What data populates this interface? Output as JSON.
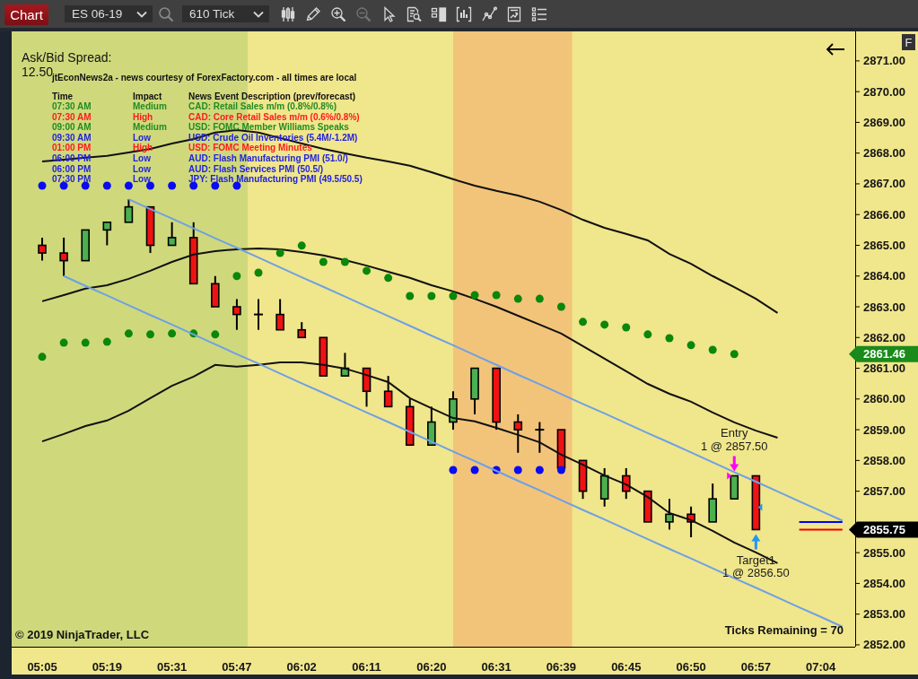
{
  "toolbar": {
    "title_button": "Chart",
    "instrument": "ES 06-19",
    "interval": "610 Tick",
    "tools": [
      {
        "kind": "candles",
        "disabled": false
      },
      {
        "kind": "pencil",
        "disabled": false
      },
      {
        "kind": "zoomin",
        "disabled": false
      },
      {
        "kind": "zoomout",
        "disabled": true
      },
      {
        "kind": "pointer",
        "disabled": false
      },
      {
        "kind": "finddoc",
        "disabled": false
      },
      {
        "kind": "panels",
        "disabled": false
      },
      {
        "kind": "indicators",
        "disabled": false
      },
      {
        "kind": "nodes",
        "disabled": false
      },
      {
        "kind": "report",
        "disabled": false
      },
      {
        "kind": "list",
        "disabled": false
      }
    ]
  },
  "chart": {
    "axis_button": "F",
    "spread_label": "Ask/Bid Spread:",
    "spread_value": "12.50",
    "news": {
      "title": "jtEconNews2a - news courtesy of ForexFactory.com - all times are local",
      "columns": [
        "Time",
        "Impact",
        "News Event Description (prev/forecast)"
      ],
      "rows": [
        {
          "time": "07:30 AM",
          "impact": "Medium",
          "event": "CAD: Retail Sales m/m (0.8%/0.8%)",
          "color": "#228b22"
        },
        {
          "time": "07:30 AM",
          "impact": "High",
          "event": "CAD: Core Retail Sales m/m (0.6%/0.8%)",
          "color": "#ff1a1a"
        },
        {
          "time": "09:00 AM",
          "impact": "Medium",
          "event": "USD: FOMC Member Williams Speaks",
          "color": "#228b22"
        },
        {
          "time": "09:30 AM",
          "impact": "Low",
          "event": "USD: Crude Oil Inventories (5.4M/-1.2M)",
          "color": "#2222dd"
        },
        {
          "time": "01:00 PM",
          "impact": "High",
          "event": "USD: FOMC Meeting Minutes",
          "color": "#ff1a1a"
        },
        {
          "time": "06:00 PM",
          "impact": "Low",
          "event": "AUD: Flash Manufacturing PMI (51.0/)",
          "color": "#2222dd"
        },
        {
          "time": "06:00 PM",
          "impact": "Low",
          "event": "AUD: Flash Services PMI (50.5/)",
          "color": "#2222dd"
        },
        {
          "time": "07:30 PM",
          "impact": "Low",
          "event": "JPY: Flash Manufacturing PMI (49.5/50.5)",
          "color": "#2222dd"
        }
      ]
    },
    "orders": [
      {
        "kind": "entry",
        "label": "Entry",
        "text": "1 @ 2857.50",
        "color": "#ff00ff"
      },
      {
        "kind": "target",
        "label": "Target1",
        "text": "1 @ 2856.50",
        "color": "#2196f3"
      }
    ],
    "price_tags": [
      {
        "kind": "indicator",
        "label": "2861.46",
        "color": "#1a8a1a"
      },
      {
        "kind": "last",
        "label": "2855.75",
        "color": "#000000"
      }
    ],
    "copyright": "© 2019 NinjaTrader, LLC",
    "ticks_remaining": "Ticks Remaining = 70",
    "chart_data": {
      "type": "candlestick",
      "categories": [
        "05:05",
        null,
        null,
        "05:19",
        null,
        null,
        "05:31",
        null,
        null,
        "05:47",
        null,
        null,
        "06:02",
        null,
        null,
        "06:11",
        null,
        null,
        "06:20",
        null,
        null,
        "06:31",
        null,
        null,
        "06:39",
        null,
        null,
        "06:45",
        null,
        null,
        "06:50",
        null,
        null,
        "06:57",
        null,
        null,
        "07:04",
        null
      ],
      "ohlc": [
        [
          2865.0,
          2865.25,
          2864.5,
          2864.75
        ],
        [
          2864.75,
          2865.25,
          2864.0,
          2864.5
        ],
        [
          2864.5,
          2865.5,
          2864.5,
          2865.5
        ],
        [
          2865.5,
          2865.75,
          2865.0,
          2865.75
        ],
        [
          2865.75,
          2866.5,
          2865.75,
          2866.25
        ],
        [
          2866.25,
          2866.25,
          2864.75,
          2865.0
        ],
        [
          2865.0,
          2865.75,
          2865.0,
          2865.25
        ],
        [
          2865.25,
          2865.75,
          2863.75,
          2863.75
        ],
        [
          2863.75,
          2864.0,
          2863.0,
          2863.0
        ],
        [
          2863.0,
          2863.25,
          2862.25,
          2862.75
        ],
        [
          2862.75,
          2863.25,
          2862.25,
          2862.75
        ],
        [
          2862.75,
          2863.25,
          2862.25,
          2862.25
        ],
        [
          2862.25,
          2862.5,
          2862.0,
          2862.0
        ],
        [
          2862.0,
          2862.0,
          2860.75,
          2860.75
        ],
        [
          2860.75,
          2861.5,
          2860.75,
          2861.0
        ],
        [
          2861.0,
          2861.0,
          2859.75,
          2860.25
        ],
        [
          2860.25,
          2860.75,
          2859.75,
          2859.75
        ],
        [
          2859.75,
          2860.0,
          2858.5,
          2858.5
        ],
        [
          2858.5,
          2859.75,
          2858.5,
          2859.25
        ],
        [
          2859.25,
          2860.25,
          2859.0,
          2860.0
        ],
        [
          2860.0,
          2861.0,
          2859.5,
          2861.0
        ],
        [
          2861.0,
          2861.0,
          2859.0,
          2859.25
        ],
        [
          2859.25,
          2859.5,
          2858.25,
          2859.0
        ],
        [
          2859.0,
          2859.25,
          2858.25,
          2859.0
        ],
        [
          2859.0,
          2859.0,
          2857.75,
          2857.75
        ],
        [
          2858.0,
          2858.0,
          2856.75,
          2857.0
        ],
        [
          2856.75,
          2857.75,
          2856.5,
          2857.5
        ],
        [
          2857.5,
          2857.75,
          2856.75,
          2857.0
        ],
        [
          2857.0,
          2857.0,
          2856.0,
          2856.0
        ],
        [
          2856.0,
          2856.75,
          2855.75,
          2856.25
        ],
        [
          2856.25,
          2856.5,
          2855.5,
          2856.0
        ],
        [
          2856.0,
          2857.25,
          2856.0,
          2856.75
        ],
        [
          2856.75,
          2857.5,
          2856.75,
          2857.5
        ],
        [
          2857.5,
          2857.5,
          2855.75,
          2855.75
        ],
        null,
        null,
        null,
        null
      ],
      "series": [
        {
          "type": "line",
          "color": "#111111",
          "values": [
            2867.73,
            2867.79,
            2867.85,
            2867.91,
            2868.02,
            2868.14,
            2868.31,
            2868.46,
            2868.67,
            2868.75,
            2868.67,
            2868.49,
            2868.31,
            2868.14,
            2867.99,
            2867.85,
            2867.73,
            2867.59,
            2867.38,
            2867.15,
            2866.94,
            2866.77,
            2866.62,
            2866.42,
            2866.15,
            2865.83,
            2865.57,
            2865.37,
            2865.16,
            2864.72,
            2864.4,
            2864.0,
            2863.64,
            2863.26,
            2862.8,
            null,
            null,
            null
          ]
        },
        {
          "type": "line",
          "color": "#111111",
          "values": [
            2863.18,
            2863.38,
            2863.59,
            2863.7,
            2863.91,
            2864.17,
            2864.46,
            2864.7,
            2864.81,
            2864.87,
            2864.9,
            2864.87,
            2864.78,
            2864.67,
            2864.52,
            2864.34,
            2864.14,
            2863.94,
            2863.7,
            2863.5,
            2863.26,
            2863.0,
            2862.71,
            2862.42,
            2862.13,
            2861.72,
            2861.31,
            2860.9,
            2860.49,
            2860.17,
            2859.91,
            2859.56,
            2859.24,
            2858.97,
            2858.74,
            null,
            null,
            null
          ]
        },
        {
          "type": "line",
          "color": "#111111",
          "values": [
            2858.62,
            2858.86,
            2859.12,
            2859.3,
            2859.62,
            2860.03,
            2860.43,
            2860.73,
            2861.11,
            2861.05,
            2861.11,
            2861.19,
            2861.19,
            2861.11,
            2860.99,
            2860.78,
            2860.55,
            2860.03,
            2859.7,
            2859.38,
            2859.27,
            2859.06,
            2858.83,
            2858.59,
            2858.19,
            2857.86,
            2857.51,
            2857.22,
            2856.81,
            2856.29,
            2856.06,
            2855.71,
            2855.33,
            2855.01,
            2854.66,
            null,
            null,
            null
          ]
        },
        {
          "type": "scatter",
          "color": "#0b870b",
          "values": [
            2861.37,
            2861.83,
            2861.83,
            2861.86,
            2862.13,
            2862.1,
            2862.13,
            2862.13,
            2862.1,
            2864.0,
            2864.11,
            2864.75,
            2864.99,
            2864.46,
            2864.46,
            2864.17,
            2863.94,
            2863.35,
            2863.35,
            2863.35,
            2863.38,
            2863.38,
            2863.26,
            2863.26,
            2863.0,
            2862.51,
            2862.42,
            2862.33,
            2862.1,
            2861.98,
            2861.75,
            2861.6,
            2861.46,
            null,
            null,
            null,
            null,
            null
          ]
        },
        {
          "type": "scatter",
          "color": "#0b0bf0",
          "values": [
            2866.94,
            2866.94,
            2866.94,
            2866.94,
            2866.94,
            2866.94,
            2866.94,
            2866.94,
            2866.94,
            2866.94,
            null,
            null,
            null,
            null,
            null,
            null,
            null,
            null,
            null,
            2857.69,
            2857.69,
            2857.69,
            2857.69,
            2857.69,
            2857.69,
            null,
            null,
            null,
            null,
            null,
            null,
            null,
            null,
            null,
            null,
            null,
            null,
            null
          ]
        },
        {
          "type": "line",
          "color": "#6fa0e6",
          "values": [
            null,
            null,
            null,
            null,
            2866.5,
            2866.18,
            2865.87,
            2865.55,
            2865.23,
            2864.92,
            2864.6,
            2864.28,
            2863.96,
            2863.65,
            2863.33,
            2863.01,
            2862.7,
            2862.38,
            2862.06,
            2861.75,
            2861.43,
            2861.11,
            2860.79,
            2860.48,
            2860.16,
            2859.84,
            2859.53,
            2859.21,
            2858.89,
            2858.58,
            2858.26,
            2857.94,
            2857.62,
            2857.31,
            2856.99,
            2856.67,
            2856.36,
            2856.04
          ]
        },
        {
          "type": "line",
          "color": "#6fa0e6",
          "values": [
            null,
            2864.0,
            2863.68,
            2863.37,
            2863.05,
            2862.73,
            2862.42,
            2862.1,
            2861.78,
            2861.46,
            2861.15,
            2860.83,
            2860.51,
            2860.2,
            2859.88,
            2859.56,
            2859.25,
            2858.93,
            2858.61,
            2858.29,
            2857.98,
            2857.66,
            2857.34,
            2857.03,
            2856.71,
            2856.39,
            2856.08,
            2855.76,
            2855.44,
            2855.12,
            2854.81,
            2854.49,
            2854.17,
            2853.86,
            2853.54,
            2853.22,
            2852.91,
            2852.59
          ]
        },
        {
          "type": "line",
          "color": "#0000ee",
          "values": [
            null,
            null,
            null,
            null,
            null,
            null,
            null,
            null,
            null,
            null,
            null,
            null,
            null,
            null,
            null,
            null,
            null,
            null,
            null,
            null,
            null,
            null,
            null,
            null,
            null,
            null,
            null,
            null,
            null,
            null,
            null,
            null,
            null,
            null,
            null,
            2856.0,
            2856.0,
            2856.0
          ]
        },
        {
          "type": "line",
          "color": "#ee0000",
          "values": [
            null,
            null,
            null,
            null,
            null,
            null,
            null,
            null,
            null,
            null,
            null,
            null,
            null,
            null,
            null,
            null,
            null,
            null,
            null,
            null,
            null,
            null,
            null,
            null,
            null,
            null,
            null,
            null,
            null,
            null,
            null,
            null,
            null,
            null,
            null,
            2855.75,
            2855.75,
            2855.75
          ]
        }
      ],
      "ylim": [
        2851.94,
        2871.96
      ],
      "yticks": [
        {
          "value": 2852,
          "label": "2852.00"
        },
        {
          "value": 2853,
          "label": "2853.00"
        },
        {
          "value": 2854,
          "label": "2854.00"
        },
        {
          "value": 2855,
          "label": "2855.00"
        },
        {
          "value": 2857,
          "label": "2857.00"
        },
        {
          "value": 2858,
          "label": "2858.00"
        },
        {
          "value": 2859,
          "label": "2859.00"
        },
        {
          "value": 2860,
          "label": "2860.00"
        },
        {
          "value": 2861,
          "label": "2861.00"
        },
        {
          "value": 2862,
          "label": "2862.00"
        },
        {
          "value": 2863,
          "label": "2863.00"
        },
        {
          "value": 2864,
          "label": "2864.00"
        },
        {
          "value": 2865,
          "label": "2865.00"
        },
        {
          "value": 2866,
          "label": "2866.00"
        },
        {
          "value": 2867,
          "label": "2867.00"
        },
        {
          "value": 2868,
          "label": "2868.00"
        },
        {
          "value": 2869,
          "label": "2869.00"
        },
        {
          "value": 2870,
          "label": "2870.00"
        },
        {
          "value": 2871,
          "label": "2871.00"
        }
      ]
    }
  }
}
